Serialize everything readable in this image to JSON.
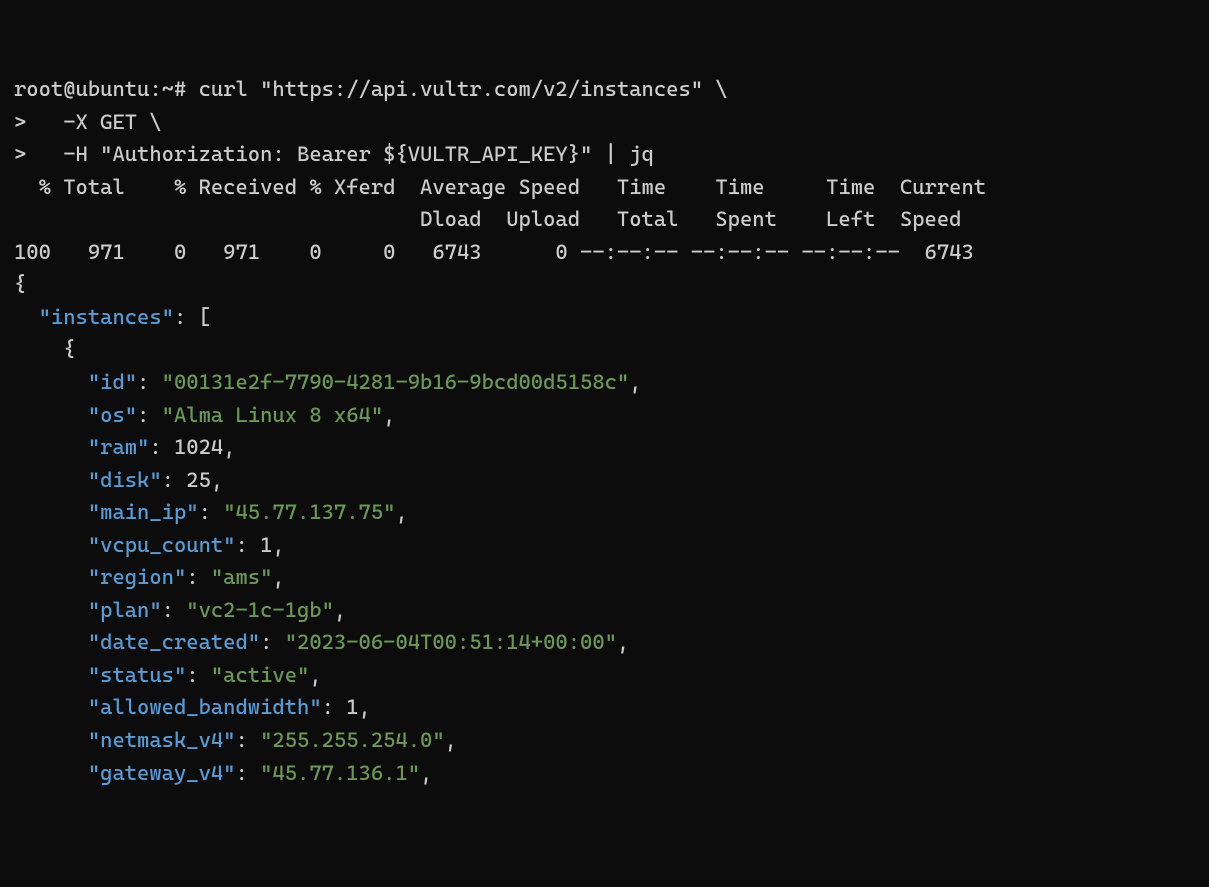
{
  "prompt": {
    "line1_prefix": "root@ubuntu:~# ",
    "line1_cmd": "curl \"https://api.vultr.com/v2/instances\" \\",
    "line2_prefix": ">   ",
    "line2_cmd": "-X GET \\",
    "line3_prefix": ">   ",
    "line3_cmd": "-H \"Authorization: Bearer ${VULTR_API_KEY}\" | jq"
  },
  "curl_header": {
    "row1": "  % Total    % Received % Xferd  Average Speed   Time    Time     Time  Current",
    "row2": "                                 Dload  Upload   Total   Spent    Left  Speed",
    "row3": "100   971    0   971    0     0   6743      0 --:--:-- --:--:-- --:--:--  6743"
  },
  "json": {
    "open_brace": "{",
    "instances_key": "\"instances\"",
    "colon_arr": ": [",
    "obj_open": "    {",
    "items": [
      {
        "key": "\"id\"",
        "val": "\"00131e2f-7790-4281-9b16-9bcd00d5158c\"",
        "type": "str"
      },
      {
        "key": "\"os\"",
        "val": "\"Alma Linux 8 x64\"",
        "type": "str"
      },
      {
        "key": "\"ram\"",
        "val": "1024",
        "type": "num"
      },
      {
        "key": "\"disk\"",
        "val": "25",
        "type": "num"
      },
      {
        "key": "\"main_ip\"",
        "val": "\"45.77.137.75\"",
        "type": "str"
      },
      {
        "key": "\"vcpu_count\"",
        "val": "1",
        "type": "num"
      },
      {
        "key": "\"region\"",
        "val": "\"ams\"",
        "type": "str"
      },
      {
        "key": "\"plan\"",
        "val": "\"vc2-1c-1gb\"",
        "type": "str"
      },
      {
        "key": "\"date_created\"",
        "val": "\"2023-06-04T00:51:14+00:00\"",
        "type": "str"
      },
      {
        "key": "\"status\"",
        "val": "\"active\"",
        "type": "str"
      },
      {
        "key": "\"allowed_bandwidth\"",
        "val": "1",
        "type": "num"
      },
      {
        "key": "\"netmask_v4\"",
        "val": "\"255.255.254.0\"",
        "type": "str"
      },
      {
        "key": "\"gateway_v4\"",
        "val": "\"45.77.136.1\"",
        "type": "str"
      }
    ]
  }
}
